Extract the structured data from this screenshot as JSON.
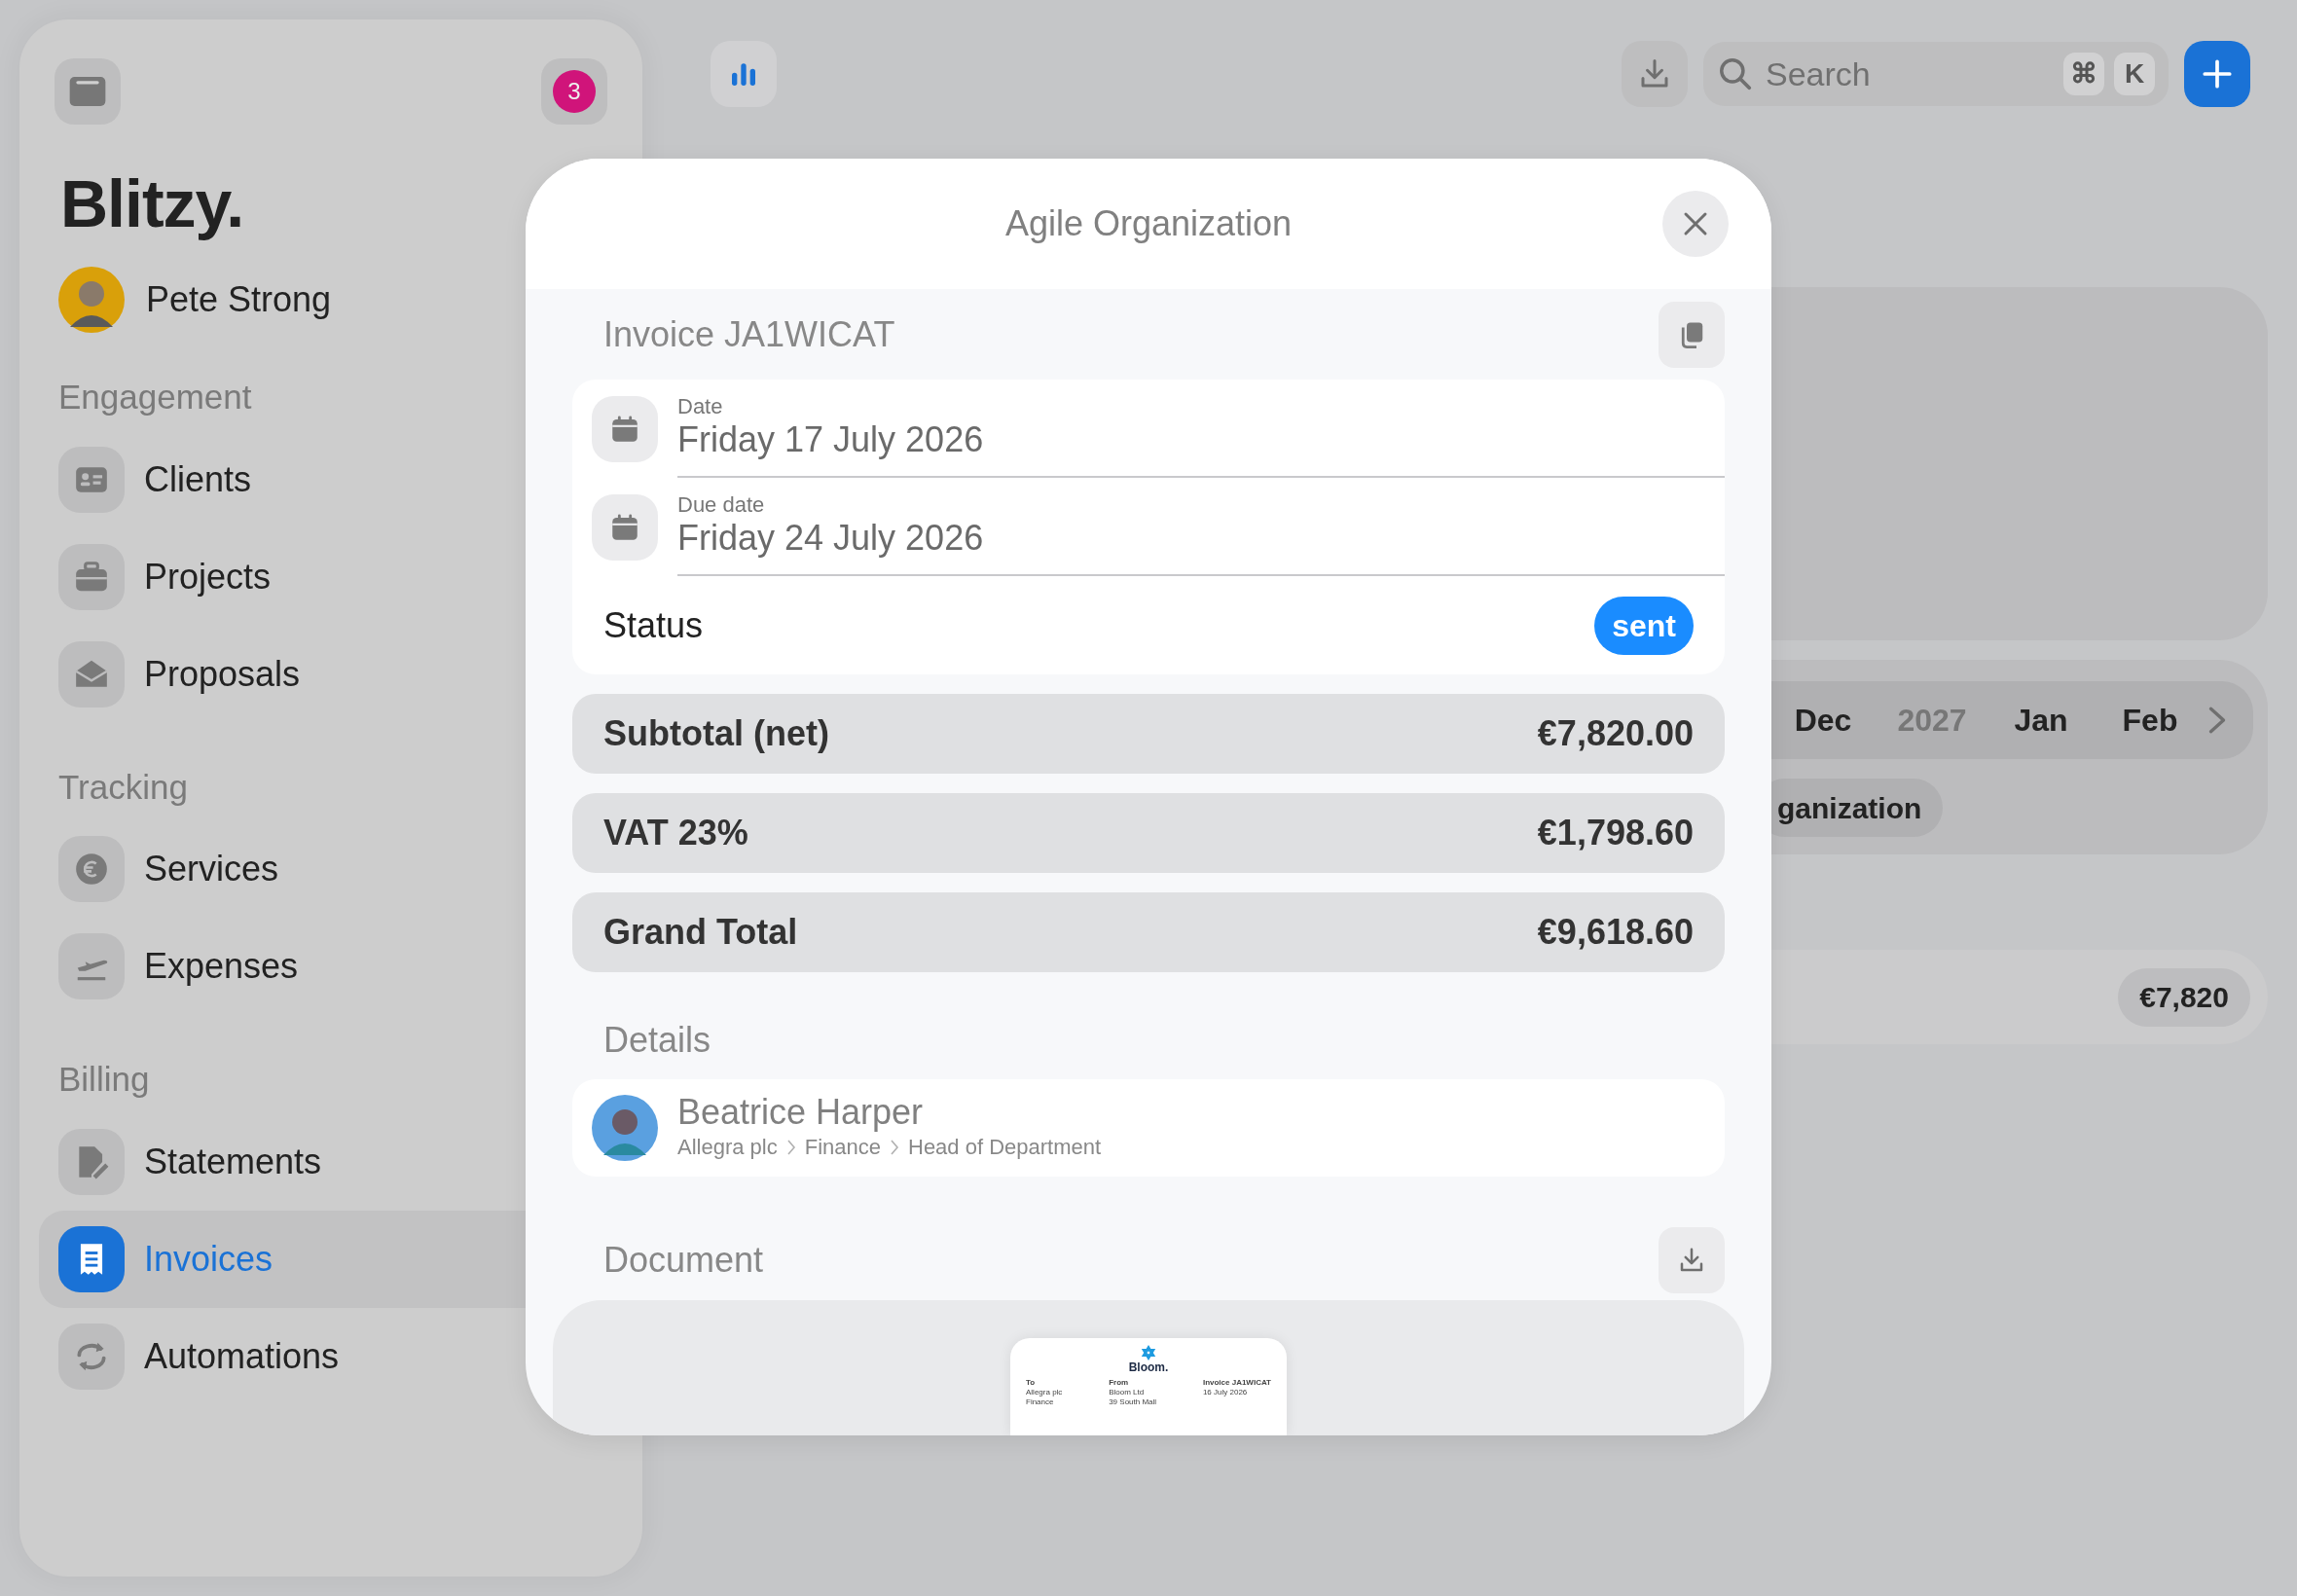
{
  "sidebar": {
    "notification_count": "3",
    "logo": "Blitzy.",
    "user": {
      "name": "Pete Strong"
    },
    "sections": [
      {
        "title": "Engagement",
        "items": [
          {
            "label": "Clients",
            "selected": false
          },
          {
            "label": "Projects",
            "selected": false
          },
          {
            "label": "Proposals",
            "selected": false
          }
        ]
      },
      {
        "title": "Tracking",
        "items": [
          {
            "label": "Services",
            "selected": false
          },
          {
            "label": "Expenses",
            "selected": false
          }
        ]
      },
      {
        "title": "Billing",
        "items": [
          {
            "label": "Statements",
            "selected": false
          },
          {
            "label": "Invoices",
            "selected": true
          },
          {
            "label": "Automations",
            "selected": false
          }
        ]
      }
    ]
  },
  "toolbar": {
    "search": {
      "placeholder": "Search"
    },
    "shortcut_keys": [
      "⌘",
      "K"
    ]
  },
  "background": {
    "month_strip": [
      {
        "label": "Dec",
        "kind": "month"
      },
      {
        "label": "2027",
        "kind": "year"
      },
      {
        "label": "Jan",
        "kind": "month"
      },
      {
        "label": "Feb",
        "kind": "month"
      }
    ],
    "tag": "ganization",
    "amount": "€7,820"
  },
  "modal": {
    "title": "Agile Organization",
    "invoice_title": "Invoice JA1WICAT",
    "dates": [
      {
        "label": "Date",
        "value": "Friday 17 July 2026"
      },
      {
        "label": "Due date",
        "value": "Friday 24 July 2026"
      }
    ],
    "status": {
      "label": "Status",
      "value": "sent"
    },
    "totals": [
      {
        "label": "Subtotal (net)",
        "amount": "€7,820.00"
      },
      {
        "label": "VAT 23%",
        "amount": "€1,798.60"
      },
      {
        "label": "Grand Total",
        "amount": "€9,618.60"
      }
    ],
    "details_heading": "Details",
    "contact": {
      "name": "Beatrice Harper",
      "path": [
        "Allegra plc",
        "Finance",
        "Head of Department"
      ]
    },
    "document_heading": "Document",
    "document_preview": {
      "brand": "Bloom.",
      "columns": [
        [
          "To",
          "Allegra plc",
          "Finance"
        ],
        [
          "From",
          "Bloom Ltd",
          "39 South Mall"
        ],
        [
          "Invoice JA1WICAT",
          "16 July 2026"
        ]
      ]
    }
  }
}
